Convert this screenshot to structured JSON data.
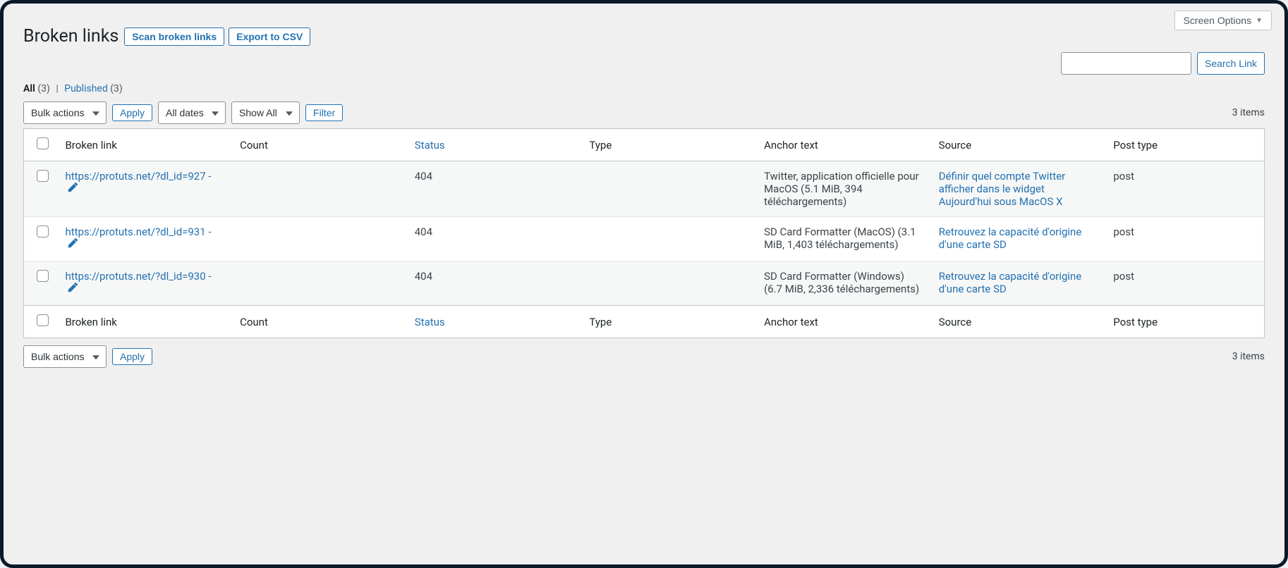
{
  "screen_options": "Screen Options",
  "page_title": "Broken links",
  "header_buttons": {
    "scan": "Scan broken links",
    "export": "Export to CSV"
  },
  "filters": {
    "all_label": "All",
    "all_count": "(3)",
    "separator": "|",
    "published_label": "Published",
    "published_count": "(3)"
  },
  "search": {
    "button": "Search Link",
    "placeholder": ""
  },
  "bulk": {
    "selected": "Bulk actions",
    "apply": "Apply"
  },
  "date_filter": {
    "selected": "All dates"
  },
  "show_filter": {
    "selected": "Show All"
  },
  "filter_button": "Filter",
  "items_count": "3 items",
  "columns": {
    "broken_link": "Broken link",
    "count": "Count",
    "status": "Status",
    "type": "Type",
    "anchor": "Anchor text",
    "source": "Source",
    "post_type": "Post type"
  },
  "rows": [
    {
      "url": "https://protuts.net/?dl_id=927 -",
      "count": "",
      "status": "404",
      "type": "",
      "anchor": "Twitter, application officielle pour MacOS (5.1 MiB, 394 téléchargements)",
      "source": "Définir quel compte Twitter afficher dans le widget Aujourd'hui sous MacOS X",
      "post_type": "post"
    },
    {
      "url": "https://protuts.net/?dl_id=931 -",
      "count": "",
      "status": "404",
      "type": "",
      "anchor": "SD Card Formatter (MacOS) (3.1 MiB, 1,403 téléchargements)",
      "source": "Retrouvez la capacité d'origine d'une carte SD",
      "post_type": "post"
    },
    {
      "url": "https://protuts.net/?dl_id=930 -",
      "count": "",
      "status": "404",
      "type": "",
      "anchor": "SD Card Formatter (Windows) (6.7 MiB, 2,336 téléchargements)",
      "source": "Retrouvez la capacité d'origine d'une carte SD",
      "post_type": "post"
    }
  ]
}
